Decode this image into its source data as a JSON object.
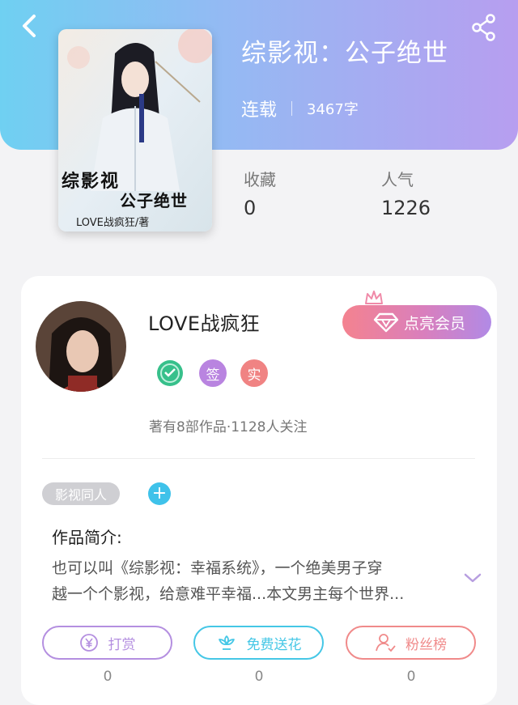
{
  "book": {
    "title": "综影视：公子绝世",
    "status": "连载",
    "word_count": "3467字",
    "cover_title": "综影视",
    "cover_subtitle": "公子绝世",
    "cover_author": "LOVE战疯狂/著"
  },
  "stats": {
    "favorites_label": "收藏",
    "favorites_value": "0",
    "popularity_label": "人气",
    "popularity_value": "1226"
  },
  "author": {
    "name": "LOVE战疯狂",
    "badges": [
      {
        "name": "level-badge-icon",
        "color": "#37c08b"
      },
      {
        "name": "signed",
        "label": "签",
        "color": "#b984e0"
      },
      {
        "name": "verified",
        "label": "实",
        "color": "#f08383"
      }
    ],
    "works_summary": "著有8部作品·1128人关注",
    "vip_button": "点亮会员"
  },
  "tags": {
    "items": [
      "影视同人"
    ],
    "add_label": "+"
  },
  "intro": {
    "heading": "作品简介:",
    "lines": [
      "也可以叫《综影视：幸福系统》，一个绝美男子穿",
      "越一个个影视，给意难平幸福...本文男主每个世界..."
    ]
  },
  "actions": [
    {
      "label": "打赏",
      "count": "0",
      "color": "#b48fe0",
      "icon": "yen-icon"
    },
    {
      "label": "免费送花",
      "count": "0",
      "color": "#45c7e6",
      "icon": "flower-icon"
    },
    {
      "label": "粉丝榜",
      "count": "0",
      "color": "#f08a8a",
      "icon": "fans-icon"
    }
  ]
}
